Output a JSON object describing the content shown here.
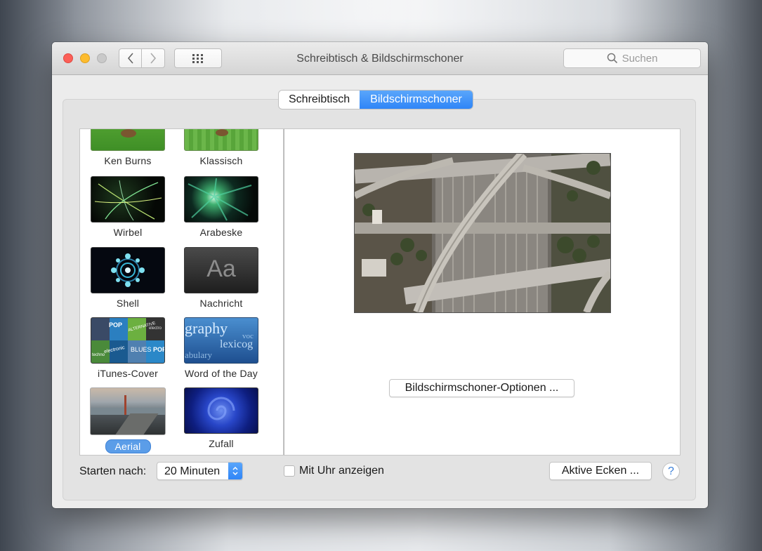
{
  "window": {
    "title": "Schreibtisch & Bildschirmschoner"
  },
  "toolbar": {
    "search_placeholder": "Suchen"
  },
  "tabs": [
    {
      "label": "Schreibtisch",
      "active": false
    },
    {
      "label": "Bildschirmschoner",
      "active": true
    }
  ],
  "screensavers": [
    {
      "label": "Ken Burns",
      "icon": "ken-burns-thumb",
      "selected": false
    },
    {
      "label": "Klassisch",
      "icon": "klassisch-thumb",
      "selected": false
    },
    {
      "label": "Wirbel",
      "icon": "wirbel-thumb",
      "selected": false
    },
    {
      "label": "Arabeske",
      "icon": "arabeske-thumb",
      "selected": false
    },
    {
      "label": "Shell",
      "icon": "shell-thumb",
      "selected": false
    },
    {
      "label": "Nachricht",
      "icon": "nachricht-thumb",
      "thumb_text": "Aa",
      "selected": false
    },
    {
      "label": "iTunes-Cover",
      "icon": "itunes-cover-thumb",
      "thumb_texts": [
        "POP",
        "ALTERNATIVE",
        "electro",
        "BLUES",
        "POP",
        "electronic",
        "techno"
      ],
      "selected": false
    },
    {
      "label": "Word of the Day",
      "icon": "word-of-the-day-thumb",
      "thumb_texts": [
        "graphy",
        "voc",
        "lexicog",
        "abulary"
      ],
      "selected": false
    },
    {
      "label": "Aerial",
      "icon": "aerial-thumb",
      "selected": true
    },
    {
      "label": "Zufall",
      "icon": "zufall-thumb",
      "selected": false
    }
  ],
  "preview": {
    "options_button": "Bildschirmschoner-Optionen ..."
  },
  "bottom": {
    "start_after_label": "Starten nach:",
    "start_after_value": "20 Minuten",
    "show_clock_label": "Mit Uhr anzeigen",
    "show_clock_checked": false,
    "hot_corners_button": "Aktive Ecken ...",
    "help_label": "?"
  },
  "colors": {
    "accent": "#3b8ff8",
    "close": "#fc5f57",
    "minimize": "#fdbc2e"
  }
}
